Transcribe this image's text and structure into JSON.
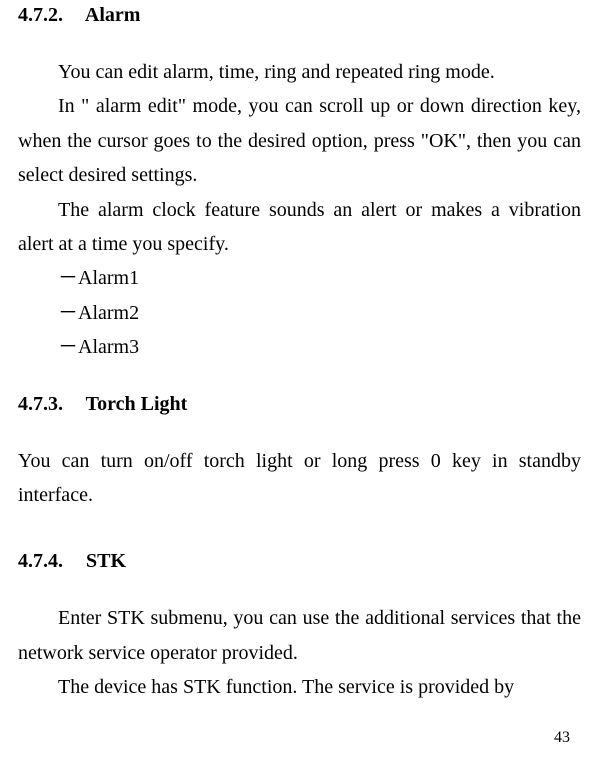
{
  "sections": [
    {
      "number": "4.7.2.",
      "title": "Alarm",
      "paragraphs": [
        "You can edit alarm, time, ring and repeated ring mode.",
        "In \" alarm edit\" mode,  you can scroll up or down direction key, when the cursor goes to the desired option, press \"OK\", then you can select desired settings.",
        "The alarm clock feature sounds an alert or makes a vibration alert at a time you specify."
      ],
      "list": [
        "－Alarm1",
        "－Alarm2",
        "－Alarm3"
      ]
    },
    {
      "number": "4.7.3.",
      "title": "Torch Light",
      "paragraphs": [
        "You can turn on/off torch light or long press 0 key in standby interface."
      ],
      "list": []
    },
    {
      "number": "4.7.4.",
      "title": "STK",
      "paragraphs": [
        "Enter STK submenu, you can use the additional services that the network service operator provided.",
        "The device has STK function. The service is provided by"
      ],
      "list": []
    }
  ],
  "pageNumber": "43"
}
